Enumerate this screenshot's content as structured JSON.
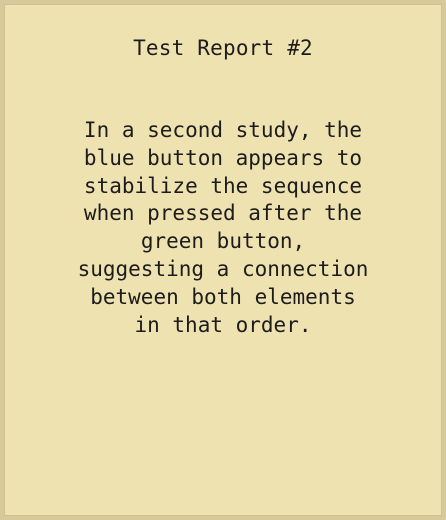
{
  "note": {
    "title": "Test Report #2",
    "lines": [
      "In a second study, the",
      "blue button appears to",
      "stabilize the sequence",
      "when pressed after the",
      "green button,",
      "suggesting a connection",
      "between both elements",
      "in that order."
    ]
  },
  "colors": {
    "background": "#d6c99a",
    "paper": "#efe2b1",
    "text": "#1c1c1c"
  }
}
